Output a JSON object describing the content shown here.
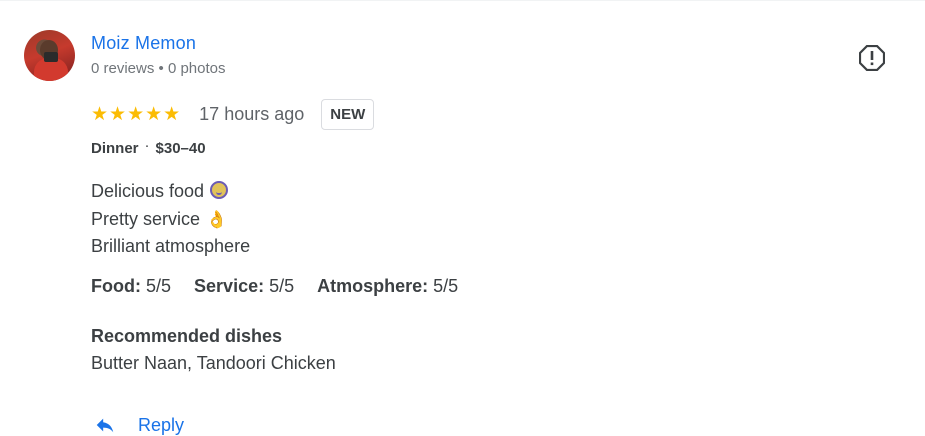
{
  "reviewer": {
    "name": "Moiz Memon",
    "meta": "0 reviews • 0 photos"
  },
  "review": {
    "stars": "★★★★★",
    "rating_value": 5,
    "time_ago": "17 hours ago",
    "badge": "NEW",
    "meal": "Dinner",
    "separator": "·",
    "price": "$30–40",
    "lines": [
      "Delicious food",
      "Pretty service",
      "Brilliant atmosphere"
    ],
    "scores": [
      {
        "label": "Food:",
        "value": "5/5"
      },
      {
        "label": "Service:",
        "value": "5/5"
      },
      {
        "label": "Atmosphere:",
        "value": "5/5"
      }
    ],
    "recommended_title": "Recommended dishes",
    "recommended_value": "Butter Naan, Tandoori Chicken"
  },
  "actions": {
    "reply_label": "Reply"
  },
  "icons": {
    "report": "report-icon",
    "reply": "reply-icon"
  },
  "colors": {
    "link": "#1a73e8",
    "star": "#fbbc04",
    "text": "#3c4043",
    "muted": "#70757a"
  }
}
